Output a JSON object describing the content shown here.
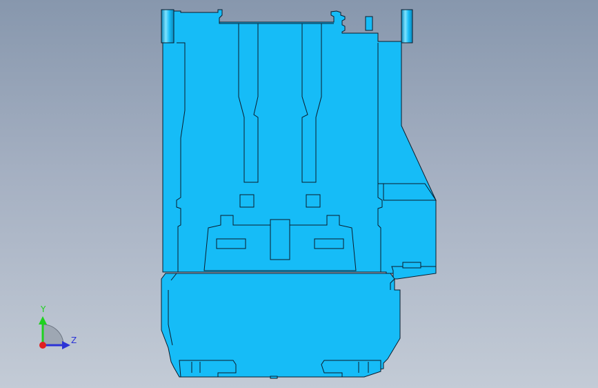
{
  "viewport": {
    "background_top": "#8797ad",
    "background_bottom": "#c3cbd6",
    "part_color": "#16bcf7",
    "part_shadow_color": "#0fa6dc",
    "edge_color": "#0b1a2a"
  },
  "triad": {
    "y_label": "Y",
    "z_label": "Z",
    "y_color": "#1fd21f",
    "z_color": "#2b33d6",
    "origin_color": "#e02020"
  }
}
